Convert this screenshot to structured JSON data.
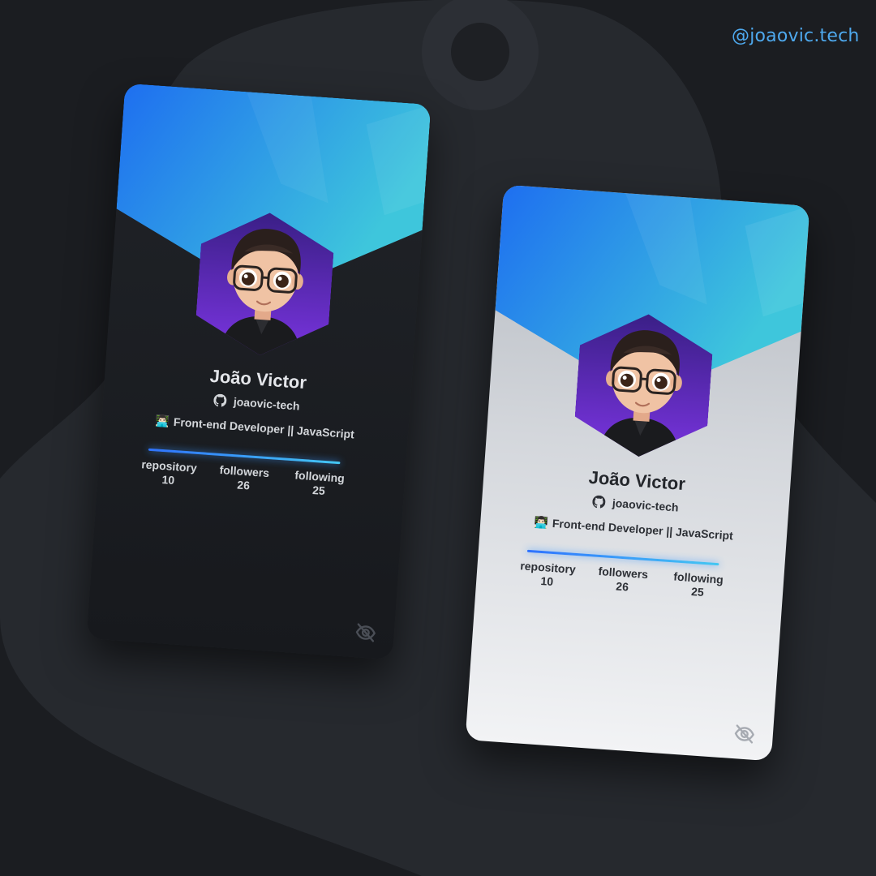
{
  "handle": "@joaovic.tech",
  "colors": {
    "background": "#1b1d21",
    "accent": "#4ea9ee",
    "banner_start": "#1e6ff0",
    "banner_end": "#3ec6dc",
    "avatar_bg": "#6a2fd1",
    "divider_start": "#2f73ff",
    "divider_end": "#44c7f2"
  },
  "cards": [
    {
      "theme": "dark",
      "name": "João Victor",
      "github_icon": "github-icon",
      "login": "joaovic-tech",
      "bio_emoji": "👨🏻‍💻",
      "bio": "Front-end Developer || JavaScript",
      "stats": [
        {
          "label": "repository",
          "value": "10"
        },
        {
          "label": "followers",
          "value": "26"
        },
        {
          "label": "following",
          "value": "25"
        }
      ],
      "toggle_icon": "eye-off-icon"
    },
    {
      "theme": "light",
      "name": "João Victor",
      "github_icon": "github-icon",
      "login": "joaovic-tech",
      "bio_emoji": "👨🏻‍💻",
      "bio": "Front-end Developer || JavaScript",
      "stats": [
        {
          "label": "repository",
          "value": "10"
        },
        {
          "label": "followers",
          "value": "26"
        },
        {
          "label": "following",
          "value": "25"
        }
      ],
      "toggle_icon": "eye-off-icon"
    }
  ]
}
